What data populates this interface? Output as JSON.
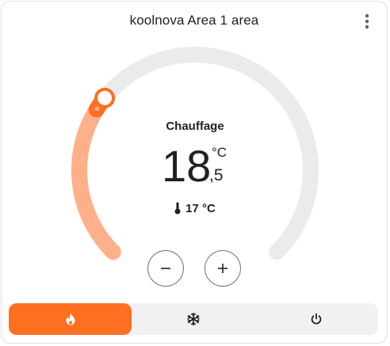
{
  "card": {
    "title": "koolnova Area 1 area",
    "menu_icon": "dots-vertical-icon"
  },
  "thermostat": {
    "mode_label": "Chauffage",
    "target_integer": "18",
    "target_decimal": ",5",
    "target_unit": "°C",
    "current_temperature": "17 °C",
    "current_icon": "thermometer-icon",
    "setpoint_fraction": 0.31,
    "colors": {
      "heat_accent": "#ff6f22",
      "heat_track": "#ffb08a",
      "inactive_track": "#ebebeb"
    }
  },
  "controls": {
    "decrease_icon": "minus-icon",
    "increase_icon": "plus-icon"
  },
  "modes": [
    {
      "name": "heat",
      "icon": "flame-icon",
      "active": true
    },
    {
      "name": "cool",
      "icon": "snowflake-icon",
      "active": false
    },
    {
      "name": "off",
      "icon": "power-icon",
      "active": false
    }
  ]
}
